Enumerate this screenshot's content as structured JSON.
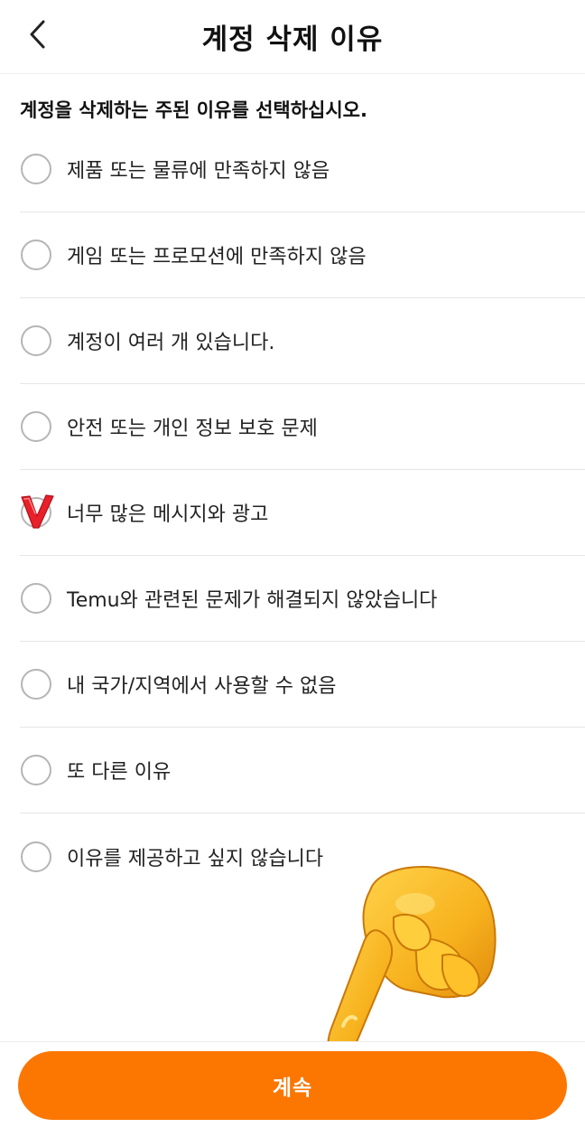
{
  "header": {
    "back_icon": "chevron-left-icon",
    "title": "계정 삭제 이유"
  },
  "instruction": "계정을 삭제하는 주된 이유를 선택하십시오.",
  "options": [
    {
      "label": "제품 또는 물류에 만족하지 않음",
      "selected": false
    },
    {
      "label": "게임 또는 프로모션에 만족하지 않음",
      "selected": false
    },
    {
      "label": "계정이 여러 개 있습니다.",
      "selected": false
    },
    {
      "label": "안전 또는 개인 정보 보호 문제",
      "selected": false
    },
    {
      "label": "너무 많은 메시지와 광고",
      "selected": true
    },
    {
      "label": "Temu와 관련된 문제가 해결되지 않았습니다",
      "selected": false
    },
    {
      "label": "내 국가/지역에서 사용할 수 없음",
      "selected": false
    },
    {
      "label": "또 다른 이유",
      "selected": false
    },
    {
      "label": "이유를 제공하고 싶지 않습니다",
      "selected": false
    }
  ],
  "footer": {
    "continue_label": "계속"
  },
  "colors": {
    "accent": "#fb7701",
    "check_mark": "#e8202a",
    "radio_border": "#b5b5b5"
  },
  "overlay": {
    "icon": "pointing-hand-icon"
  }
}
